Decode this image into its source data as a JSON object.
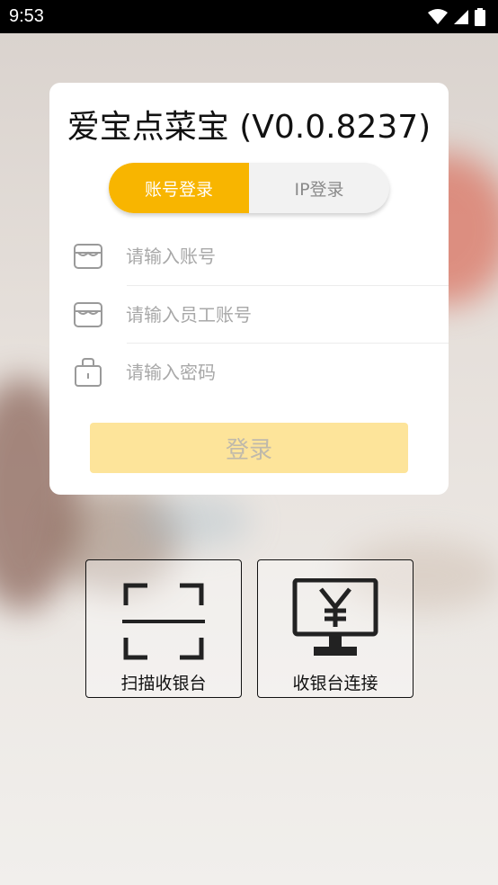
{
  "status_bar": {
    "time": "9:53",
    "icons": [
      "wifi-icon",
      "signal-icon",
      "battery-icon"
    ]
  },
  "card": {
    "title": "爱宝点菜宝 (V0.0.8237)",
    "tabs": [
      {
        "label": "账号登录",
        "active": true
      },
      {
        "label": "IP登录",
        "active": false
      }
    ],
    "fields": [
      {
        "placeholder": "请输入账号",
        "icon": "store-icon",
        "value": ""
      },
      {
        "placeholder": "请输入员工账号",
        "icon": "store-icon",
        "value": ""
      },
      {
        "placeholder": "请输入密码",
        "icon": "lock-icon",
        "value": ""
      }
    ],
    "login_label": "登录"
  },
  "actions": [
    {
      "label": "扫描收银台",
      "icon": "scan-icon"
    },
    {
      "label": "收银台连接",
      "icon": "cashier-monitor-icon"
    }
  ],
  "colors": {
    "accent": "#f8b500",
    "login_disabled": "#fde49a"
  }
}
